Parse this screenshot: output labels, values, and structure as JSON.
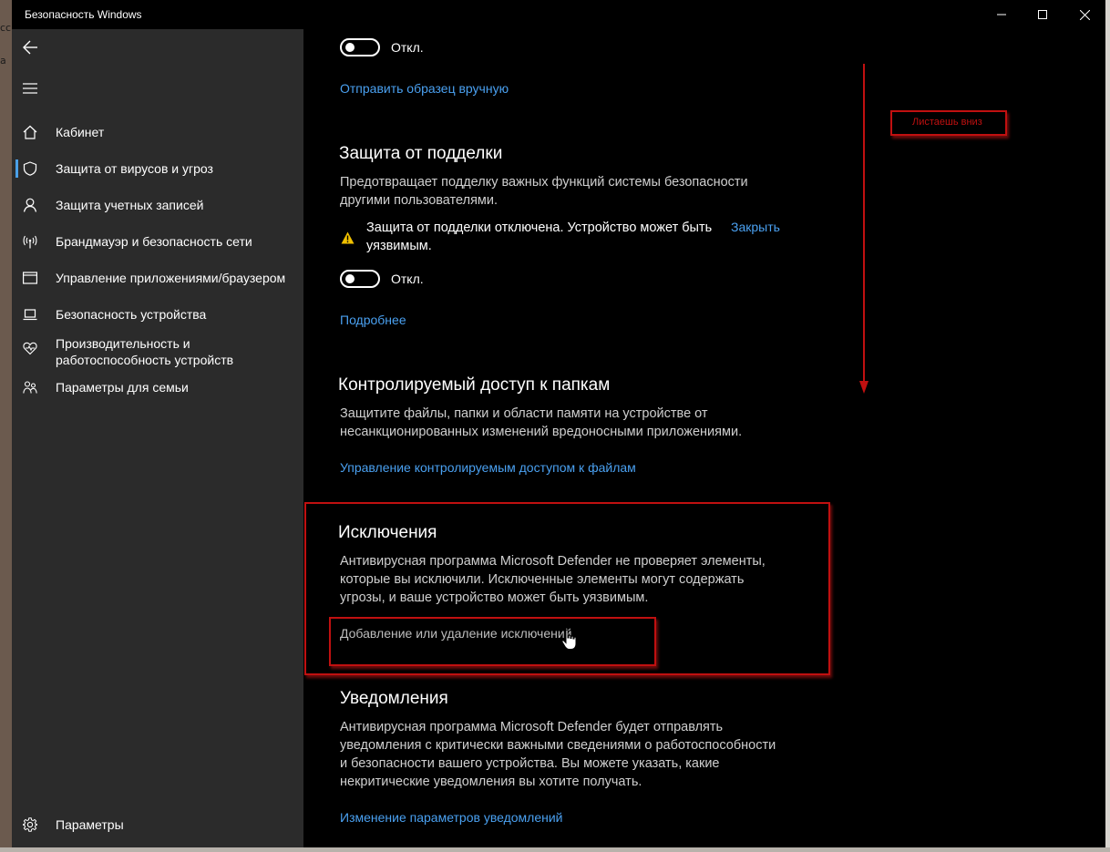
{
  "window": {
    "title": "Безопасность Windows",
    "controls": {
      "minimize_icon": "minimize-icon",
      "maximize_icon": "maximize-icon",
      "close_icon": "close-icon"
    }
  },
  "background_fragments": [
    "сс",
    "а"
  ],
  "sidebar": {
    "back_icon": "back-arrow-icon",
    "menu_icon": "hamburger-menu-icon",
    "items": [
      {
        "label": "Кабинет",
        "icon": "home-icon",
        "selected": false
      },
      {
        "label": "Защита от вирусов и угроз",
        "icon": "shield-icon",
        "selected": true
      },
      {
        "label": "Защита учетных записей",
        "icon": "person-icon",
        "selected": false
      },
      {
        "label": "Брандмауэр и безопасность сети",
        "icon": "wireless-icon",
        "selected": false
      },
      {
        "label": "Управление приложениями/браузером",
        "icon": "app-window-icon",
        "selected": false
      },
      {
        "label": "Безопасность устройства",
        "icon": "laptop-icon",
        "selected": false
      },
      {
        "label": "Производительность и работоспособность устройств",
        "icon": "heart-pulse-icon",
        "selected": false
      },
      {
        "label": "Параметры для семьи",
        "icon": "family-icon",
        "selected": false
      }
    ],
    "settings": {
      "label": "Параметры",
      "icon": "gear-icon"
    }
  },
  "content": {
    "top_toggle": {
      "state": "Откл.",
      "on": false
    },
    "submit_sample_link": "Отправить образец вручную",
    "tamper": {
      "title": "Защита от подделки",
      "description": "Предотвращает подделку важных функций системы безопасности другими пользователями.",
      "warning_icon": "warning-icon",
      "warning_line1": "Защита от подделки отключена. Устройство может быть",
      "warning_line2": "уязвимым.",
      "dismiss_link": "Закрыть",
      "toggle_state": "Откл.",
      "toggle_on": false,
      "more_link": "Подробнее"
    },
    "folder_access": {
      "title": "Контролируемый доступ к папкам",
      "description": "Защитите файлы, папки и области памяти на устройстве от несанкционированных изменений вредоносными приложениями.",
      "manage_link": "Управление контролируемым доступом к файлам"
    },
    "exclusions": {
      "title": "Исключения",
      "description": "Антивирусная программа Microsoft Defender не проверяет элементы, которые вы исключили. Исключенные элементы могут содержать угрозы, и ваше устройство может быть уязвимым.",
      "add_remove_link": "Добавление или удаление исключений"
    },
    "notifications": {
      "title": "Уведомления",
      "description": "Антивирусная программа Microsoft Defender будет отправлять уведомления с критически важными сведениями о работоспособности и безопасности вашего устройства. Вы можете указать, какие некритические уведомления вы хотите получать.",
      "change_link": "Изменение параметров уведомлений"
    }
  },
  "annotation": {
    "scroll_label": "Листаешь вниз",
    "color": "#c01010",
    "arrow_icon": "scroll-down-arrow"
  },
  "colors": {
    "accent": "#4aa0f0",
    "sidebar_bg": "#2b2b2b",
    "content_bg": "#000000",
    "warning": "#f0c000"
  }
}
